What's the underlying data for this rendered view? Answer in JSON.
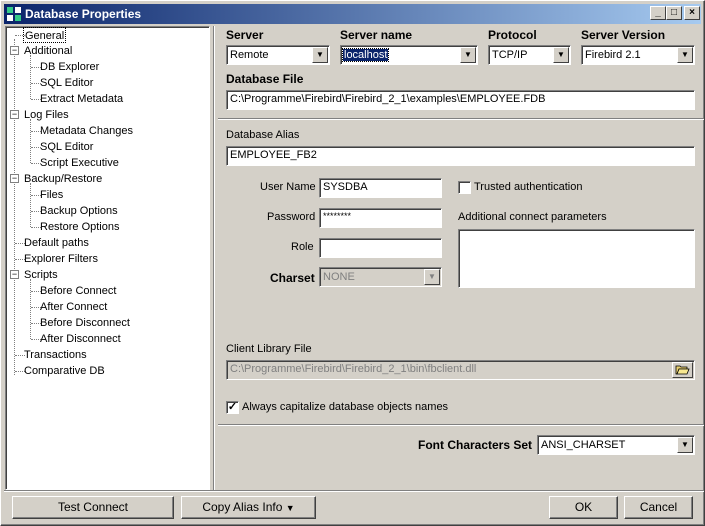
{
  "window": {
    "title": "Database Properties",
    "min": "_",
    "max": "□",
    "close": "×"
  },
  "tree": {
    "items": [
      {
        "label": "General"
      },
      {
        "label": "Additional"
      },
      {
        "label": "DB Explorer"
      },
      {
        "label": "SQL Editor"
      },
      {
        "label": "Extract Metadata"
      },
      {
        "label": "Log Files"
      },
      {
        "label": "Metadata Changes"
      },
      {
        "label": "SQL Editor"
      },
      {
        "label": "Script Executive"
      },
      {
        "label": "Backup/Restore"
      },
      {
        "label": "Files"
      },
      {
        "label": "Backup Options"
      },
      {
        "label": "Restore Options"
      },
      {
        "label": "Default paths"
      },
      {
        "label": "Explorer Filters"
      },
      {
        "label": "Scripts"
      },
      {
        "label": "Before Connect"
      },
      {
        "label": "After Connect"
      },
      {
        "label": "Before Disconnect"
      },
      {
        "label": "After Disconnect"
      },
      {
        "label": "Transactions"
      },
      {
        "label": "Comparative DB"
      }
    ],
    "expander": "−"
  },
  "server": {
    "label": "Server",
    "value": "Remote"
  },
  "server_name": {
    "label": "Server name",
    "value": "localhost"
  },
  "protocol": {
    "label": "Protocol",
    "value": "TCP/IP"
  },
  "server_version": {
    "label": "Server Version",
    "value": "Firebird 2.1"
  },
  "database_file": {
    "label": "Database File",
    "value": "C:\\Programme\\Firebird\\Firebird_2_1\\examples\\EMPLOYEE.FDB"
  },
  "database_alias": {
    "label": "Database Alias",
    "value": "EMPLOYEE_FB2"
  },
  "user_name": {
    "label": "User Name",
    "value": "SYSDBA"
  },
  "password": {
    "label": "Password",
    "value": "********"
  },
  "role": {
    "label": "Role",
    "value": ""
  },
  "charset": {
    "label": "Charset",
    "value": "NONE"
  },
  "trusted": {
    "label": "Trusted authentication",
    "checked": false
  },
  "additional_params": {
    "label": "Additional connect parameters"
  },
  "client_library": {
    "label": "Client Library File",
    "value": "C:\\Programme\\Firebird\\Firebird_2_1\\bin\\fbclient.dll"
  },
  "capitalize": {
    "label": "Always capitalize database objects names",
    "checked": true,
    "mark": "✓"
  },
  "font_charset": {
    "label": "Font Characters Set",
    "value": "ANSI_CHARSET"
  },
  "buttons": {
    "test_connect": "Test Connect",
    "copy_alias": "Copy Alias Info",
    "ok": "OK",
    "cancel": "Cancel"
  },
  "arrow": "▼"
}
